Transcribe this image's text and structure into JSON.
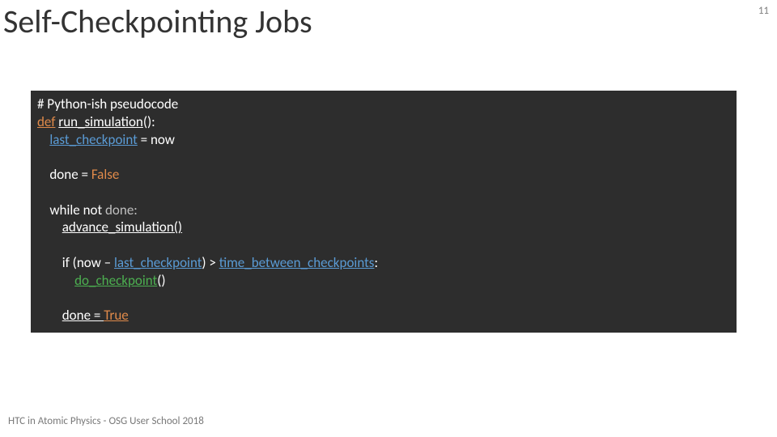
{
  "slide": {
    "title": "Self-Checkpointing Jobs",
    "page_number": "11",
    "footer": "HTC in Atomic Physics - OSG User School 2018"
  },
  "code": {
    "l1": "# Python-ish pseudocode",
    "l2a": "def",
    "l2b": "run_simulation",
    "l2c": "():",
    "l3a": "last_checkpoint",
    "l3b": " = now",
    "l5a": "done = ",
    "l5b": "False",
    "l7a": "while not ",
    "l7b": "done:",
    "l8": "advance_simulation()",
    "l10a": "if (now – ",
    "l10b": "last_checkpoint",
    "l10c": ") > ",
    "l10d": "time_between_checkpoints",
    "l10e": ":",
    "l11a": "do_checkpoint",
    "l11b": "()",
    "l13a": "done = ",
    "l13b": "True"
  }
}
